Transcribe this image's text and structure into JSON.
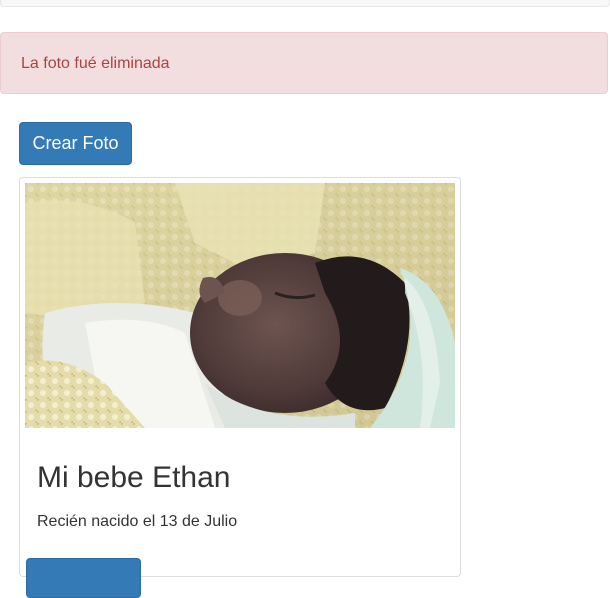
{
  "alert": {
    "message": "La foto fué eliminada",
    "type": "danger"
  },
  "toolbar": {
    "create_label": "Crear Foto"
  },
  "photos": [
    {
      "title": "Mi bebe Ethan",
      "description": "Recién nacido el 13 de Julio"
    }
  ],
  "colors": {
    "primary": "#337ab7",
    "alert_bg": "#f2dede",
    "alert_text": "#a94442"
  }
}
